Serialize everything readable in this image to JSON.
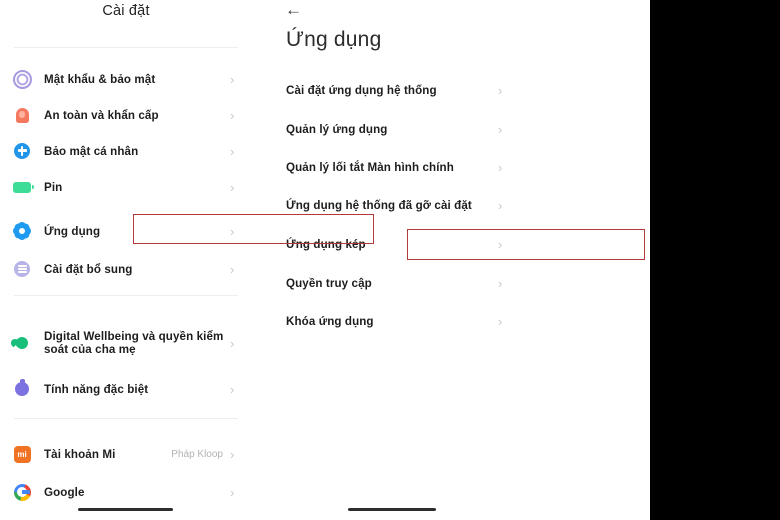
{
  "left_pane": {
    "title": "Cài đặt",
    "items": [
      {
        "label": "Mật khẩu & bảo mật",
        "icon": "fingerprint-icon",
        "value": "",
        "chevron": "›"
      },
      {
        "label": "An toàn và khẩn cấp",
        "icon": "emergency-bell-icon",
        "value": "",
        "chevron": "›"
      },
      {
        "label": "Bảo mật cá nhân",
        "icon": "privacy-shield-icon",
        "value": "",
        "chevron": "›"
      },
      {
        "label": "Pin",
        "icon": "battery-icon",
        "value": "",
        "chevron": "›"
      },
      {
        "label": "Ứng dụng",
        "icon": "apps-gear-icon",
        "value": "",
        "chevron": "›"
      },
      {
        "label": "Cài đặt bổ sung",
        "icon": "additional-settings-icon",
        "value": "",
        "chevron": "›"
      },
      {
        "label": "Digital Wellbeing và quyền kiểm soát của cha mẹ",
        "icon": "digital-wellbeing-icon",
        "value": "",
        "chevron": "›"
      },
      {
        "label": "Tính năng đặc biệt",
        "icon": "special-features-icon",
        "value": "",
        "chevron": "›"
      },
      {
        "label": "Tài khoản Mi",
        "icon": "mi-account-icon",
        "value": "Pháp Kloop",
        "chevron": "›"
      },
      {
        "label": "Google",
        "icon": "google-icon",
        "value": "",
        "chevron": "›"
      }
    ],
    "mi_icon_text": "mi",
    "highlighted_item": "Ứng dụng"
  },
  "right_pane": {
    "back_icon": "←",
    "title": "Ứng dụng",
    "items": [
      {
        "label": "Cài đặt ứng dụng hệ thống",
        "chevron": "›"
      },
      {
        "label": "Quản lý ứng dụng",
        "chevron": "›"
      },
      {
        "label": "Quản lý lối tắt Màn hình chính",
        "chevron": "›"
      },
      {
        "label": "Ứng dụng hệ thống đã gỡ cài đặt",
        "chevron": "›"
      },
      {
        "label": "Ứng dụng kép",
        "chevron": "›"
      },
      {
        "label": "Quyền truy cập",
        "chevron": "›"
      },
      {
        "label": "Khóa ứng dụng",
        "chevron": "›"
      }
    ],
    "highlighted_item": "Ứng dụng kép"
  },
  "colors": {
    "background": "#000000",
    "surface": "#ffffff",
    "highlight_box": "#b03a3a",
    "primary_text": "#1d1d1d",
    "secondary_text": "#b3b3b3",
    "chevron": "#c9c9c9"
  }
}
